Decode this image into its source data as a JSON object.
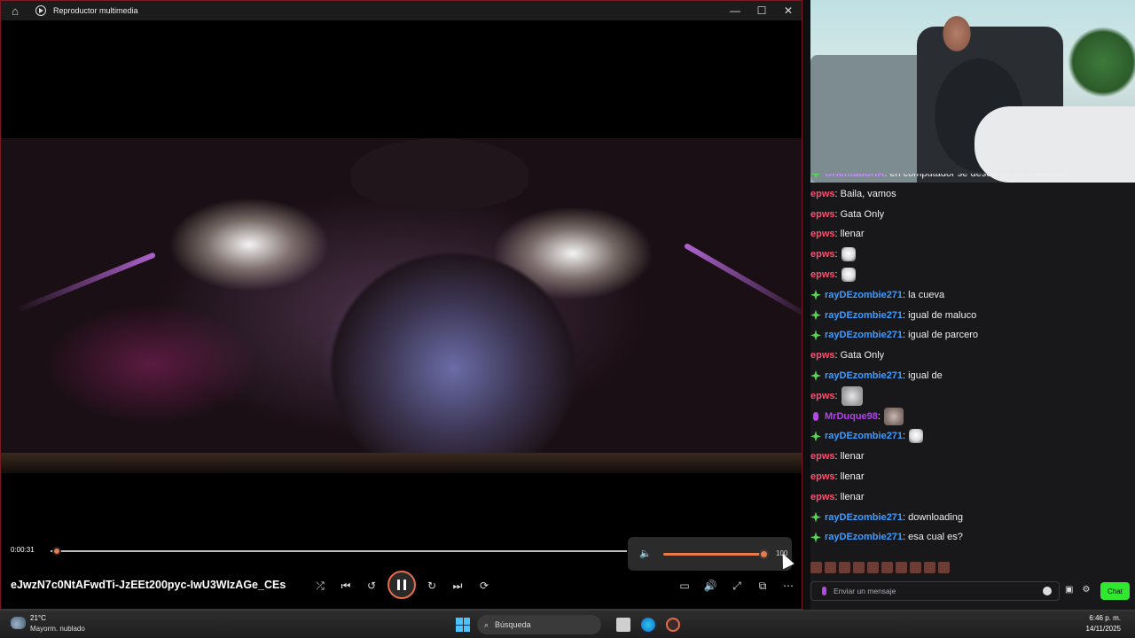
{
  "player": {
    "title": "Reproductor multimedia",
    "current_time": "0:00:31",
    "progress_fraction": 0.01,
    "volume": "100",
    "file_name": "eJwzN7c0NtAFwdTi-JzEEt200pyc-IwU3WIzAGe_CEs"
  },
  "chat": {
    "messages": [
      {
        "user": "OrientadorIA",
        "text": ": en computador se descarga un emulador",
        "badge": "star",
        "color": "#c48dff"
      },
      {
        "user": "epws",
        "text": ": Baila, vamos",
        "badge": "",
        "color": "#ff4f6d"
      },
      {
        "user": "epws",
        "text": ": Gata Only",
        "badge": "",
        "color": "#ff4f6d"
      },
      {
        "user": "epws",
        "text": ": llenar",
        "badge": "",
        "color": "#ff4f6d"
      },
      {
        "user": "epws",
        "text": ":",
        "badge": "",
        "color": "#ff4f6d",
        "emote": "goose"
      },
      {
        "user": "epws",
        "text": ":",
        "badge": "",
        "color": "#ff4f6d",
        "emote": "goose"
      },
      {
        "user": "rayDEzombie271",
        "text": ": la cueva",
        "badge": "star",
        "color": "#3f9cff"
      },
      {
        "user": "rayDEzombie271",
        "text": ": igual de maluco",
        "badge": "star",
        "color": "#3f9cff"
      },
      {
        "user": "rayDEzombie271",
        "text": ": igual de parcero",
        "badge": "star",
        "color": "#3f9cff"
      },
      {
        "user": "epws",
        "text": ": Gata Only",
        "badge": "",
        "color": "#ff4f6d"
      },
      {
        "user": "rayDEzombie271",
        "text": ": igual de",
        "badge": "star",
        "color": "#3f9cff"
      },
      {
        "user": "epws",
        "text": ":",
        "badge": "",
        "color": "#ff4f6d",
        "emote": "cat"
      },
      {
        "user": "MrDuque98",
        "text": ":",
        "badge": "mic",
        "color": "#b045e8",
        "emote": "pig"
      },
      {
        "user": "rayDEzombie271",
        "text": ":",
        "badge": "star",
        "color": "#3f9cff",
        "emote": "goose"
      },
      {
        "user": "epws",
        "text": ": llenar",
        "badge": "",
        "color": "#ff4f6d"
      },
      {
        "user": "epws",
        "text": ": llenar",
        "badge": "",
        "color": "#ff4f6d"
      },
      {
        "user": "epws",
        "text": ": llenar",
        "badge": "",
        "color": "#ff4f6d"
      },
      {
        "user": "rayDEzombie271",
        "text": ": downloading",
        "badge": "star",
        "color": "#3f9cff"
      },
      {
        "user": "rayDEzombie271",
        "text": ": esa cual es?",
        "badge": "star",
        "color": "#3f9cff"
      }
    ],
    "input_placeholder": "Enviar un mensaje",
    "send_label": "Chat"
  },
  "taskbar": {
    "temperature": "21°C",
    "weather": "Mayorm. nublado",
    "search_label": "Búsqueda",
    "time": "6:46 p. m.",
    "date": "14/11/2025"
  },
  "colors": {
    "accent": "#e96b4a",
    "chat_send": "#2fe82f",
    "user_epws": "#ff4f6d",
    "user_ray": "#3f9cff",
    "user_mrduque": "#b045e8"
  }
}
